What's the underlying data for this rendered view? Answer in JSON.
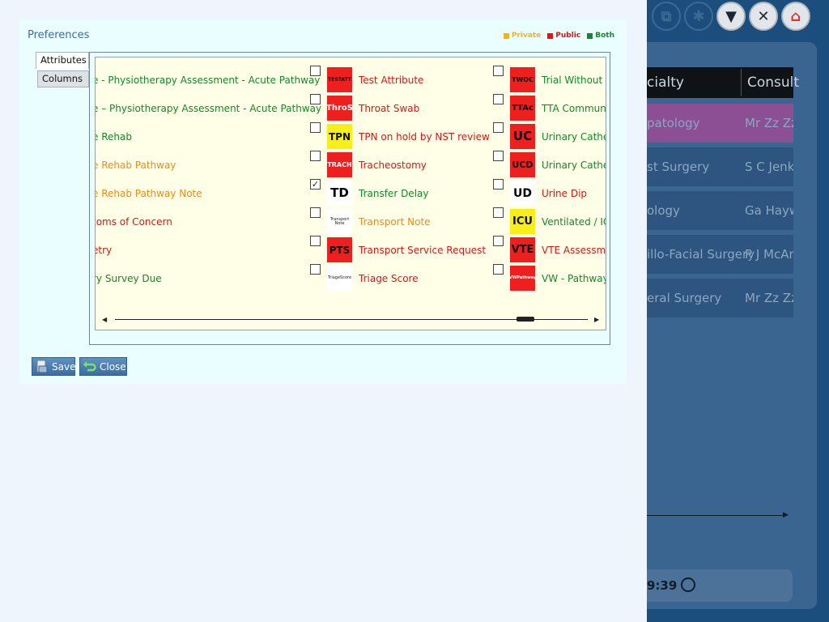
{
  "dialog": {
    "title": "Preferences",
    "legend": [
      {
        "label": "Private",
        "color": "#f5b31a"
      },
      {
        "label": "Public",
        "color": "#e01414"
      },
      {
        "label": "Both",
        "color": "#108a2a"
      }
    ],
    "tabs": [
      {
        "label": "Attributes",
        "selected": true
      },
      {
        "label": "Columns",
        "selected": false
      }
    ],
    "columns": [
      [
        {
          "label": "e - Physiotherapy Assessment - Acute Pathway",
          "scope": "both"
        },
        {
          "label": "e – Physiotherapy Assessment - Acute Pathway",
          "scope": "both"
        },
        {
          "label": "e Rehab",
          "scope": "both"
        },
        {
          "label": "e Rehab Pathway",
          "scope": "private"
        },
        {
          "label": "e Rehab Pathway Note",
          "scope": "private"
        },
        {
          "label": "toms of Concern",
          "scope": "public"
        },
        {
          "label": "etry",
          "scope": "public"
        },
        {
          "label": "ry Survey Due",
          "scope": "both"
        }
      ],
      [
        {
          "badge": "TESTATT",
          "label": "Test Attribute",
          "scope": "public",
          "checked": false,
          "style": "red"
        },
        {
          "badge": "ThroS",
          "label": "Throat Swab",
          "scope": "public",
          "checked": false,
          "style": "red-white"
        },
        {
          "badge": "TPN",
          "label": "TPN on hold by NST review",
          "scope": "public",
          "checked": false,
          "style": "yellow"
        },
        {
          "badge": "TRACH",
          "label": "Tracheostomy",
          "scope": "public",
          "checked": false,
          "style": "red-white"
        },
        {
          "badge": "TD",
          "label": "Transfer Delay",
          "scope": "both",
          "checked": true,
          "style": "plain"
        },
        {
          "badge": "Transport Note",
          "label": "Transport Note",
          "scope": "private",
          "checked": false,
          "style": "plainwhite"
        },
        {
          "badge": "PTS",
          "label": "Transport Service Request",
          "scope": "public",
          "checked": false,
          "style": "red"
        },
        {
          "badge": "TriageScore",
          "label": "Triage Score",
          "scope": "public",
          "checked": false,
          "style": "plainwhite"
        }
      ],
      [
        {
          "badge": "TWOC",
          "label": "Trial Without Ca",
          "scope": "both",
          "checked": false,
          "style": "red"
        },
        {
          "badge": "TTAc",
          "label": "TTA Community",
          "scope": "both",
          "checked": false,
          "style": "red"
        },
        {
          "badge": "UC",
          "label": "Urinary Cathete",
          "scope": "both",
          "checked": false,
          "style": "red"
        },
        {
          "badge": "UCD",
          "label": "Urinary Cathete",
          "scope": "both",
          "checked": false,
          "style": "red"
        },
        {
          "badge": "UD",
          "label": "Urine Dip",
          "scope": "public",
          "checked": false,
          "style": "plain"
        },
        {
          "badge": "ICU",
          "label": "Ventilated / ICU",
          "scope": "both",
          "checked": false,
          "style": "yellow"
        },
        {
          "badge": "VTE",
          "label": "VTE Assessmen",
          "scope": "public",
          "checked": false,
          "style": "red"
        },
        {
          "badge": "VWPathway",
          "label": "VW - Pathway",
          "scope": "both",
          "checked": false,
          "style": "red-white"
        }
      ]
    ],
    "buttons": {
      "save": "Save",
      "close": "Close"
    }
  },
  "background": {
    "headers": [
      "cialty",
      "Consult"
    ],
    "rows": [
      {
        "c1": "patology",
        "c2": "Mr Zz Zz",
        "color": "#8c4f93"
      },
      {
        "c1": "st Surgery",
        "c2": "S C Jenk",
        "color": "#2d557f"
      },
      {
        "c1": "ology",
        "c2": "Ga Hayw",
        "color": "#2d557f"
      },
      {
        "c1": "illo-Facial Surgery",
        "c2": "P J McAr",
        "color": "#2d557f"
      },
      {
        "c1": "eral Surgery",
        "c2": "Mr Zz Zz",
        "color": "#2d557f"
      }
    ],
    "time": "9:39"
  }
}
